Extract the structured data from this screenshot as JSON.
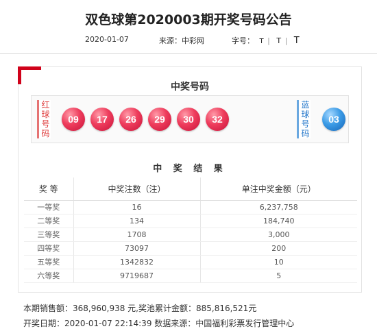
{
  "article": {
    "title": "双色球第2020003期开奖号码公告",
    "date": "2020-01-07",
    "source": "来源：中彩网",
    "font_size_label": "字号：",
    "font_sizes": [
      "T",
      "T",
      "T"
    ],
    "sep": "|"
  },
  "draw": {
    "section_title": "中奖号码",
    "red_label": "红球号码",
    "blue_label": "蓝球号码",
    "red_balls": [
      "09",
      "17",
      "26",
      "29",
      "30",
      "32"
    ],
    "blue_ball": "03"
  },
  "results": {
    "title": "中 奖 结 果",
    "headers": [
      "奖 等",
      "中奖注数（注）",
      "单注中奖金额（元）"
    ],
    "rows": [
      {
        "level": "一等奖",
        "count": "16",
        "amount": "6,237,758"
      },
      {
        "level": "二等奖",
        "count": "134",
        "amount": "184,740"
      },
      {
        "level": "三等奖",
        "count": "1708",
        "amount": "3,000"
      },
      {
        "level": "四等奖",
        "count": "73097",
        "amount": "200"
      },
      {
        "level": "五等奖",
        "count": "1342832",
        "amount": "10"
      },
      {
        "level": "六等奖",
        "count": "9719687",
        "amount": "5"
      }
    ]
  },
  "footer": {
    "line1": "本期销售额：368,960,938 元,奖池累计金额：885,816,521元",
    "line2": "开奖日期：2020-01-07 22:14:39 数据来源：中国福利彩票发行管理中心"
  },
  "colors": {
    "corner_accent": "#d0021b",
    "red_ball": "#e8324f",
    "blue_ball": "#2d8ad8"
  }
}
